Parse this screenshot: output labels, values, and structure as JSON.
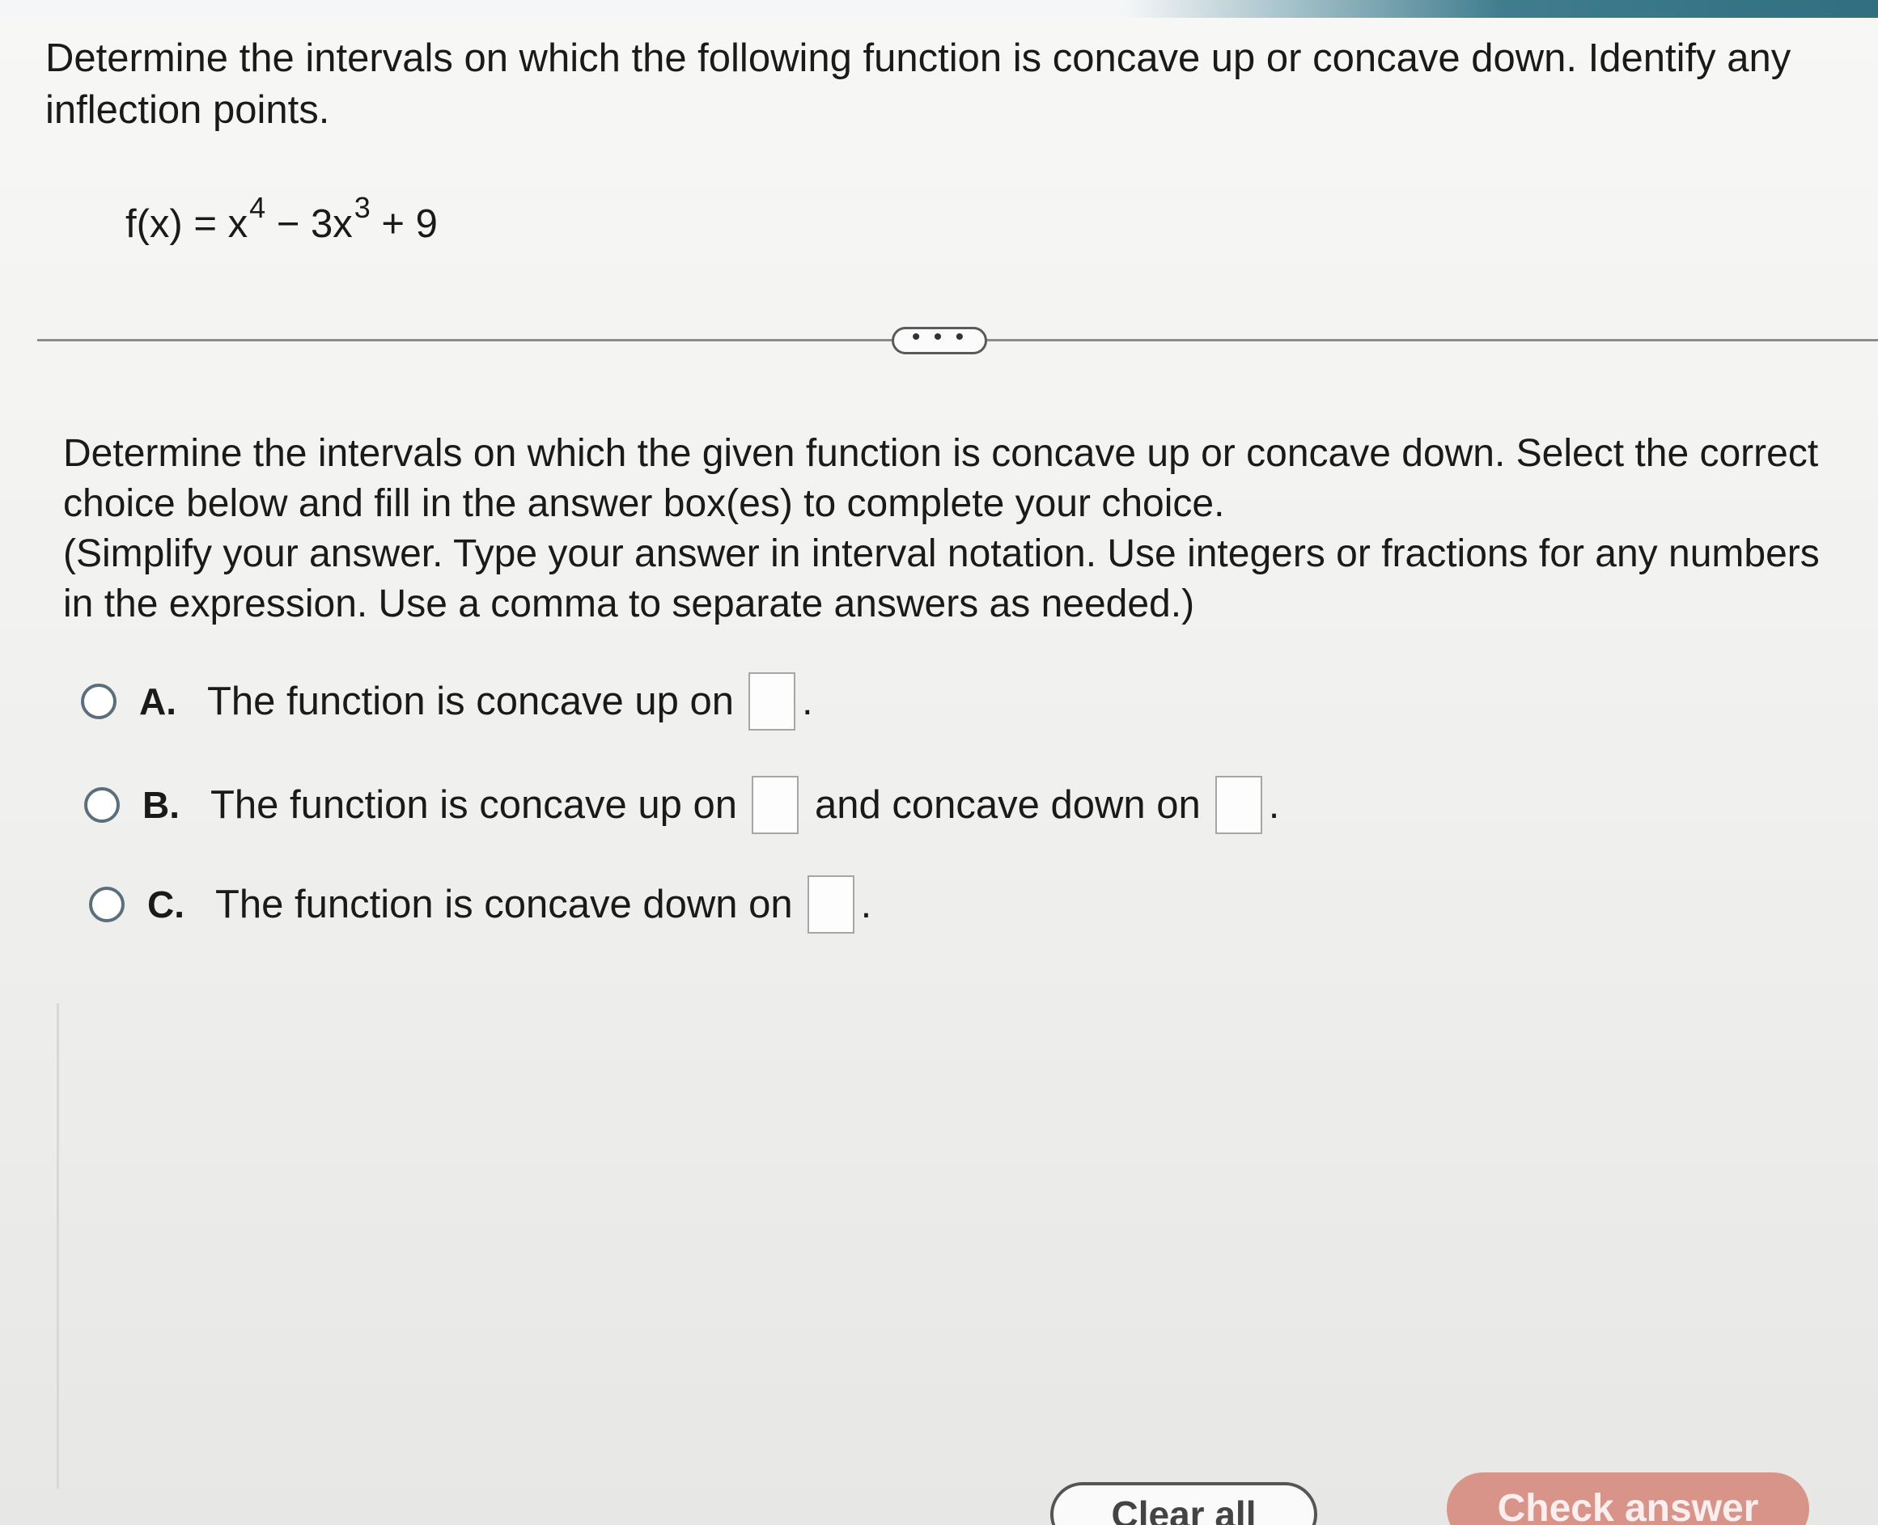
{
  "question": {
    "prompt": "Determine the intervals on which the following function is concave up or concave down. Identify any inflection points.",
    "formula": {
      "lhs": "f(x) = x",
      "exp1": "4",
      "middle": " − 3x",
      "exp2": "3",
      "rhs": " + 9"
    }
  },
  "divider": {
    "more_label": "• • •"
  },
  "part": {
    "instructions_line1": "Determine the intervals on which the given function is concave up or concave down. Select the correct choice below and fill in the answer box(es) to complete your choice.",
    "instructions_line2": "(Simplify your answer. Type your answer in interval notation. Use integers or fractions for any numbers in the expression. Use a comma to separate answers as needed.)"
  },
  "choices": [
    {
      "letter": "A.",
      "text": "The function is concave up on",
      "end": "."
    },
    {
      "letter": "B.",
      "text": "The function is concave up on",
      "middle": "and concave down on",
      "end": "."
    },
    {
      "letter": "C.",
      "text": "The function is concave down on",
      "end": "."
    }
  ],
  "footer": {
    "clear_all_label": "Clear all",
    "check_answer_label": "Check answer"
  },
  "colors": {
    "accent": "#2f6f80",
    "check_answer_bg": "#d9948a",
    "radio_border": "#5a6e7c"
  }
}
